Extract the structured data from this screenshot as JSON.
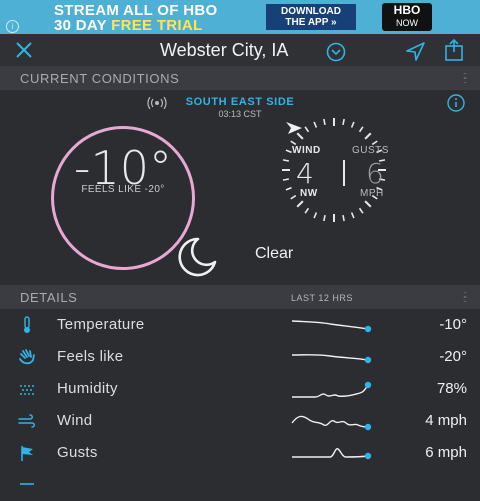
{
  "ad": {
    "line1": "STREAM ALL OF HBO",
    "line2_a": "30 DAY ",
    "line2_b": "FREE TRIAL",
    "cta_line1": "DOWNLOAD",
    "cta_line2": "THE APP »",
    "logo_line1": "HBO",
    "logo_line2": "NOW",
    "info": "i"
  },
  "header": {
    "city": "Webster City, IA"
  },
  "current": {
    "section_label": "CURRENT CONDITIONS",
    "station": "SOUTH EAST SIDE",
    "time": "03:13 CST",
    "temperature": "-10°",
    "feels_like": "FEELS LIKE -20°",
    "wind_label": "WIND",
    "gusts_label": "GUSTS",
    "wind_speed": "4",
    "gust_speed": "6",
    "wind_direction": "NW",
    "speed_unit": "MPH",
    "condition": "Clear"
  },
  "details": {
    "section_label": "DETAILS",
    "range_label": "LAST 12 HRS",
    "rows": [
      {
        "name": "Temperature",
        "value": "-10°",
        "icon": "thermometer-icon"
      },
      {
        "name": "Feels like",
        "value": "-20°",
        "icon": "hand-icon"
      },
      {
        "name": "Humidity",
        "value": "78%",
        "icon": "humidity-icon"
      },
      {
        "name": "Wind",
        "value": "4 mph",
        "icon": "wind-icon"
      },
      {
        "name": "Gusts",
        "value": "6 mph",
        "icon": "flag-icon"
      }
    ]
  },
  "colors": {
    "accent": "#32b3e5",
    "temp_ring": "#e7a9d2",
    "background": "#2b2d31",
    "section_header": "#3a3c41"
  }
}
